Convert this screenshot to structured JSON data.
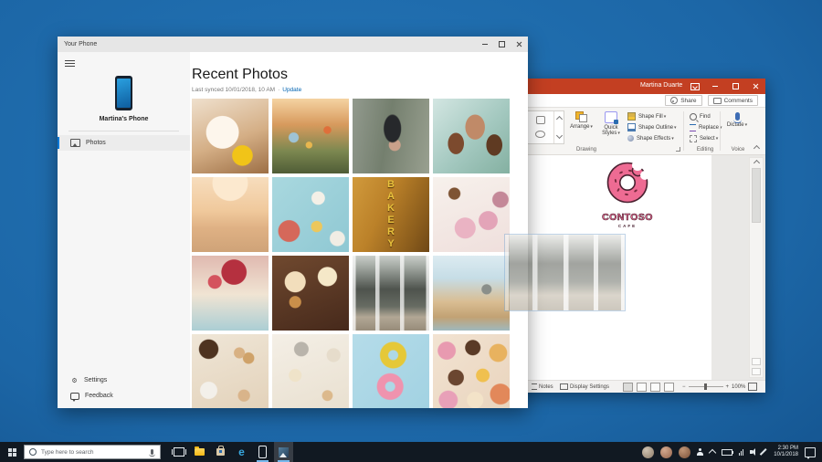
{
  "icons": {
    "gear": "⚙",
    "separator": "·",
    "edge": "e",
    "zoom_minus": "−",
    "zoom_plus": "+"
  },
  "your_phone": {
    "title": "Your Phone",
    "sidebar": {
      "device_name": "Martina's Phone",
      "nav": [
        {
          "label": "Photos"
        }
      ],
      "footer": [
        {
          "label": "Settings"
        },
        {
          "label": "Feedback"
        }
      ]
    },
    "main": {
      "heading": "Recent Photos",
      "last_synced": "Last synced 10/01/2018, 10 AM",
      "update_label": "Update",
      "photos": [
        {
          "name": "dog-with-yellow-ball",
          "style": "background:radial-gradient(circle at 66% 76%, #f1c418 0 13%, rgba(0,0,0,0) 14%),radial-gradient(circle at 40% 45%, #fdf6ec 0 26%, rgba(0,0,0,0) 27%),linear-gradient(160deg,#efe0cd 0%,#d4ae85 55%,#9d6f45 100%)"
        },
        {
          "name": "wildflower-field",
          "style": "background:radial-gradient(circle at 28% 52%, #9fc3d4 0 7%, rgba(0,0,0,0) 8%),radial-gradient(circle at 72% 42%, #df6f3a 0 5%, rgba(0,0,0,0) 6%),radial-gradient(circle at 48% 62%, #e8b64e 0 5%, rgba(0,0,0,0) 6%),linear-gradient(180deg,#f5d3a2 0%,#d79a5d 35%,#7c8850 70%,#4f5c36 100%)"
        },
        {
          "name": "feet-on-stone-path",
          "style": "background:radial-gradient(10px 16px at 52% 40%, #26282b 0 90%, rgba(0,0,0,0) 100%),radial-gradient(circle at 55% 62%, #c9a08a 0 9%, rgba(0,0,0,0) 10%),linear-gradient(100deg,#929a8e 0%,#747f6e 45%,#99a090 100%)"
        },
        {
          "name": "family-portrait",
          "style": "background:radial-gradient(9px 12px at 30% 60%, #7c4a2e 0 95%, rgba(0,0,0,0) 100%),radial-gradient(11px 14px at 55% 38%, #c08a68 0 95%, rgba(0,0,0,0) 100%),radial-gradient(9px 12px at 80% 62%, #5f3a22 0 95%, rgba(0,0,0,0) 100%),linear-gradient(135deg,#d3e6e2 0%,#a3c8bf 55%,#84b0a1 100%)"
        },
        {
          "name": "family-on-beach",
          "style": "background:radial-gradient(circle at 50% 8%, #fce9cf 0 22%, rgba(0,0,0,0) 23%),linear-gradient(180deg,#f7ddbd 0%,#f0c99c 45%,#dfb184 68%,#cfa378 100%)"
        },
        {
          "name": "food-flatlay-blue-table",
          "style": "background:radial-gradient(circle at 22% 72%, #d5685a 0 13%, rgba(0,0,0,0) 14%),radial-gradient(circle at 60% 28%, #f4f0e7 0 9%, rgba(0,0,0,0) 10%),radial-gradient(circle at 58% 66%, #ecc75c 0 8%, rgba(0,0,0,0) 9%),radial-gradient(circle at 85% 82%, #f1ede4 0 8%, rgba(0,0,0,0) 9%),linear-gradient(135deg,#a9d8df 0%,#8fc8d3 100%)"
        },
        {
          "name": "bakery-letter-sign",
          "label": "BAKERY",
          "style": "background:linear-gradient(115deg,#d19a3c 0%,#bb8129 40%,#8a5c1c 80%,#6e4716 100%)"
        },
        {
          "name": "pink-marshmallows-coffee",
          "style": "background:radial-gradient(circle at 28% 22%, #7e5434 0 7%, rgba(0,0,0,0) 8%),radial-gradient(circle at 42% 68%, #eab3c3 0 15%, rgba(0,0,0,0) 16%),radial-gradient(circle at 72% 58%, #e3a4b8 0 13%, rgba(0,0,0,0) 14%),radial-gradient(circle at 88% 30%, #c48898 0 9%, rgba(0,0,0,0) 10%),linear-gradient(160deg,#f7f1ec 0%,#efdfdc 100%)"
        },
        {
          "name": "berry-cheesecake",
          "style": "background:radial-gradient(circle at 55% 22%, #b5303f 0 17%, rgba(0,0,0,0) 18%),radial-gradient(circle at 30% 35%, #d4535e 0 9%, rgba(0,0,0,0) 10%),linear-gradient(180deg,#e0b9b0 0%,#f0e4d3 52%,#abced4 100%)"
        },
        {
          "name": "caramel-cupcakes",
          "style": "background:radial-gradient(circle at 30% 35%, #f2debc 0 14%, rgba(0,0,0,0) 15%),radial-gradient(circle at 72% 28%, #f5e8c8 0 12%, rgba(0,0,0,0) 13%),radial-gradient(circle at 30% 62%, #c98f4a 0 8%, rgba(0,0,0,0) 9%),linear-gradient(160deg,#70492f 0%,#46291b 100%)"
        },
        {
          "name": "shop-storefront",
          "style": "background:linear-gradient(90deg, rgba(255,255,255,.75) 0 4%, rgba(0,0,0,0) 4% 30%, rgba(255,255,255,.7) 30% 35%, rgba(0,0,0,0) 35% 62%, rgba(255,255,255,.7) 62% 67%, rgba(0,0,0,0) 67% 96%, rgba(255,255,255,.75) 96% 100%),linear-gradient(180deg,#c9cdc9 0%,#aab0aa 12%,#4e534d 45%,#676c63 68%,#b2a795 82%,#978c7a 100%)"
        },
        {
          "name": "cafe-interior",
          "style": "background:radial-gradient(circle at 70% 45%, #8a8f8a 0 7%, rgba(0,0,0,0) 8%),linear-gradient(180deg,#dcebf1 0%,#c6dde6 30%,#d9bd92 62%,#c2a274 82%,#9fb8bd 100%)"
        },
        {
          "name": "baking-flatlay-eggs",
          "style": "background:radial-gradient(circle at 22% 20%, #4e3320 0 11%, rgba(0,0,0,0) 12%),radial-gradient(circle at 62% 25%, #d8b183 0 7%, rgba(0,0,0,0) 8%),radial-gradient(circle at 74% 32%, #cfa269 0 7%, rgba(0,0,0,0) 8%),radial-gradient(circle at 22% 75%, #f3f0ea 0 10%, rgba(0,0,0,0) 11%),radial-gradient(circle at 68% 82%, #d9b48a 0 7%, rgba(0,0,0,0) 8%),linear-gradient(160deg,#efe6d7 0%,#e3d2ba 100%)"
        },
        {
          "name": "baking-tools-flatlay",
          "style": "background:radial-gradient(circle at 38% 20%, #b9b4ab 0 9%, rgba(0,0,0,0) 10%),radial-gradient(circle at 30% 55%, #efe3c9 0 9%, rgba(0,0,0,0) 10%),radial-gradient(circle at 80% 28%, #e6dccb 0 8%, rgba(0,0,0,0) 9%),radial-gradient(circle at 72% 82%, #dcb98c 0 6%, rgba(0,0,0,0) 7%),linear-gradient(160deg,#f4efe6 0%,#e9e0d0 100%)"
        },
        {
          "name": "two-donuts-on-blue",
          "style": "background:radial-gradient(circle at 53% 28%, #aed8e6 0 5px, #e5c838 6px 14px, rgba(0,0,0,0) 15px),radial-gradient(circle at 49% 70%, #aed8e6 0 5px, #ef93ae 6px 14px, rgba(0,0,0,0) 15px),linear-gradient(135deg,#b5dce9 0%,#a2d2e2 100%)"
        },
        {
          "name": "assorted-donuts",
          "style": "background:radial-gradient(circle at 18% 22%, #e89ab0 0 10%, rgba(0,0,0,0) 11%),radial-gradient(circle at 52% 18%, #5a3a26 0 10%, rgba(0,0,0,0) 11%),radial-gradient(circle at 85% 25%, #e8b25f 0 10%, rgba(0,0,0,0) 11%),radial-gradient(circle at 30% 58%, #6b4630 0 11%, rgba(0,0,0,0) 12%),radial-gradient(circle at 65% 55%, #f0c04f 0 10%, rgba(0,0,0,0) 11%),radial-gradient(circle at 20% 88%, #e8a0b8 0 10%, rgba(0,0,0,0) 11%),radial-gradient(circle at 55% 88%, #f3e3c8 0 10%, rgba(0,0,0,0) 11%),radial-gradient(circle at 88% 80%, #e2885a 0 11%, rgba(0,0,0,0) 12%),linear-gradient(135deg,#f2e3d2,#e9d4bd)"
        }
      ]
    }
  },
  "powerpoint": {
    "title": "Martina Duarte",
    "share_label": "Share",
    "comments_label": "Comments",
    "ribbon": {
      "drawing": {
        "label": "Drawing",
        "arrange": "Arrange",
        "quick_styles": "Quick Styles",
        "shape_fill": "Shape Fill",
        "shape_outline": "Shape Outline",
        "shape_effects": "Shape Effects"
      },
      "editing": {
        "label": "Editing",
        "find": "Find",
        "replace": "Replace",
        "select": "Select"
      },
      "voice": {
        "label": "Voice",
        "dictate": "Dictate"
      }
    },
    "slide": {
      "brand": "CONTOSO",
      "brand_sub": "CAFE"
    },
    "status": {
      "notes": "Notes",
      "display_settings": "Display Settings",
      "zoom_level": "100%"
    }
  },
  "drag_ghost": {
    "name": "storefront-photo-drag",
    "style": "background:linear-gradient(90deg, rgba(255,255,255,.8) 0 3%, rgba(0,0,0,0) 3% 23%, rgba(255,255,255,.75) 23% 27%, rgba(0,0,0,0) 27% 49%, rgba(255,255,255,.75) 49% 53%, rgba(0,0,0,0) 53% 74%, rgba(255,255,255,.75) 74% 78%, rgba(0,0,0,0) 78% 97%, rgba(255,255,255,.8) 97% 100%),linear-gradient(180deg,#dededa 0%,#b9bcb6 10%,#565a52 38%,#6e7268 62%,#beb4a2 80%,#a39a89 100%)"
  },
  "taskbar": {
    "search_placeholder": "Type here to search",
    "clock": {
      "time": "2:30 PM",
      "date": "10/1/2018"
    }
  }
}
